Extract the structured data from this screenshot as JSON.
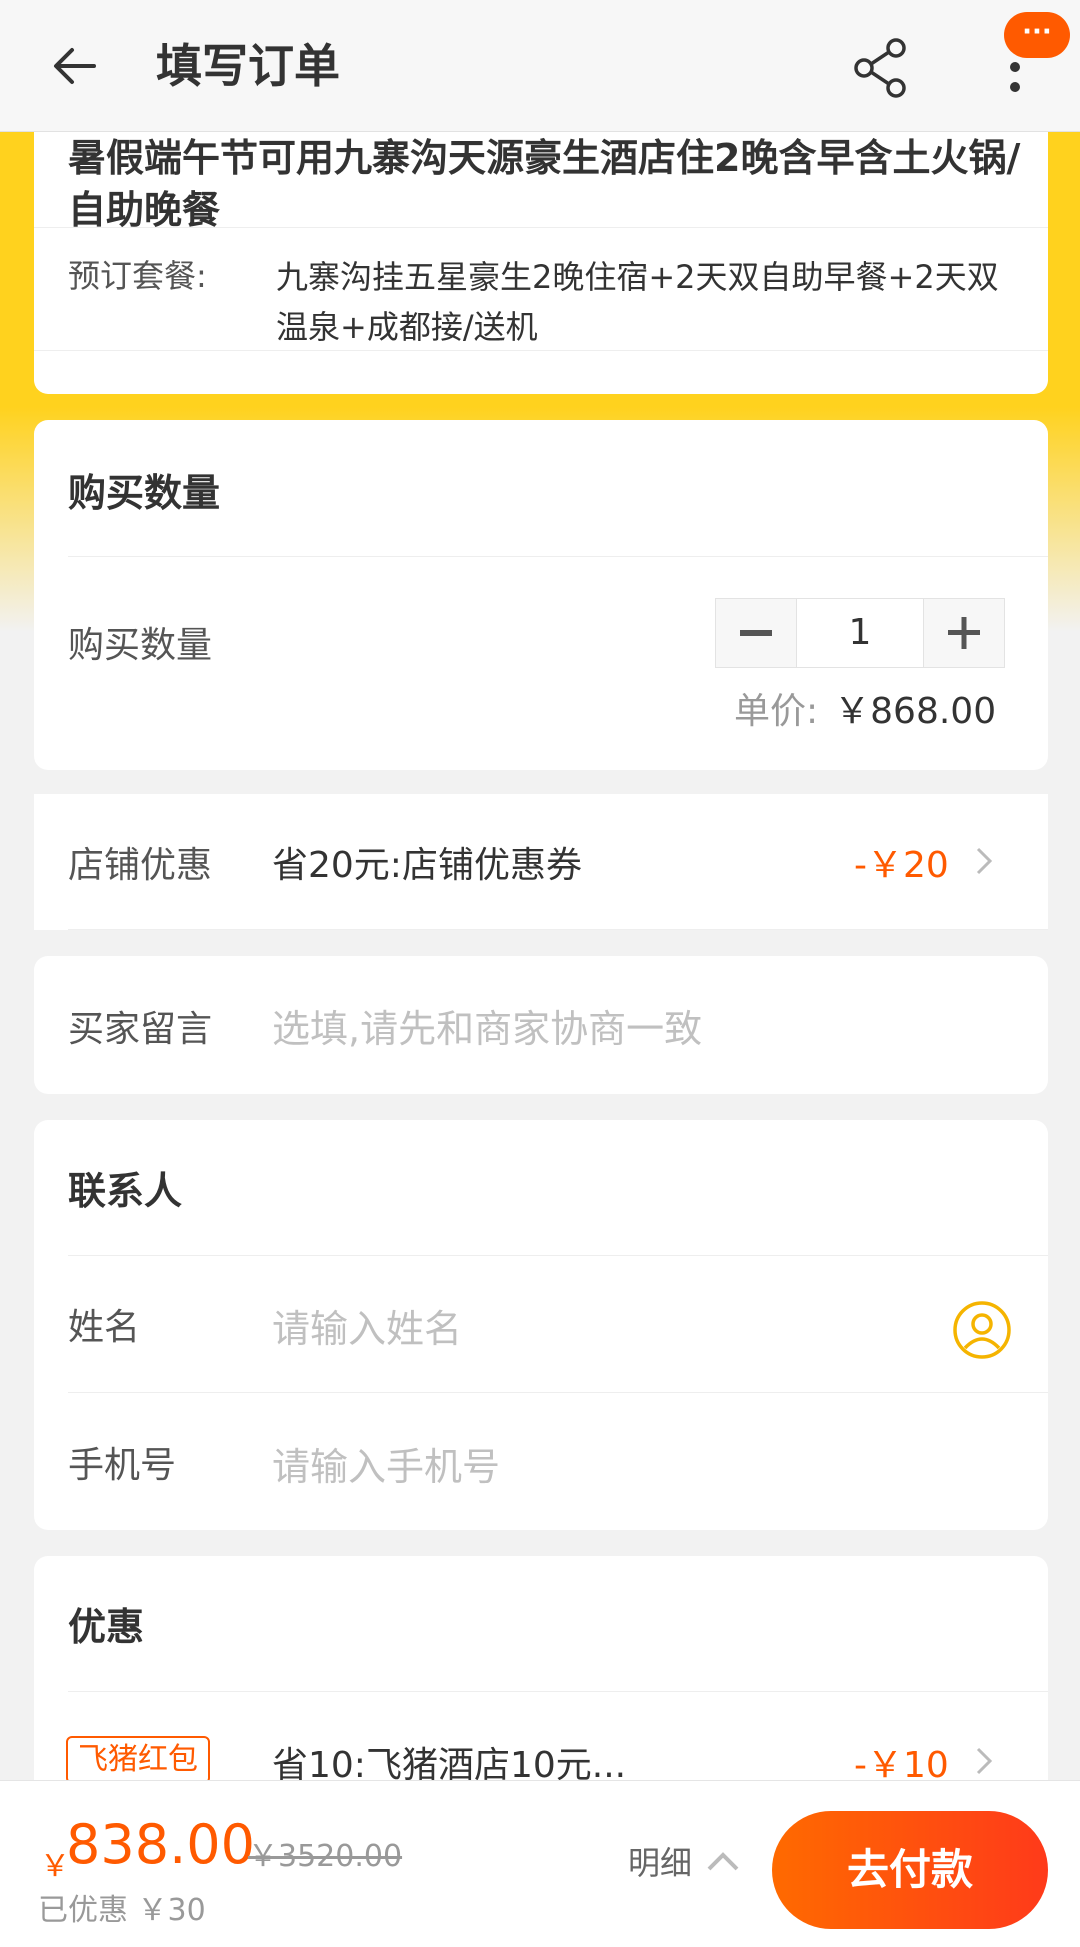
{
  "header": {
    "title": "填写订单",
    "badge": "···",
    "back_icon": "arrow-left-icon",
    "share_icon": "share-icon",
    "more_icon": "more-vertical-icon"
  },
  "product": {
    "title": "暑假端午节可用九寨沟天源豪生酒店住2晚含早含土火锅/自助晚餐",
    "package_label": "预订套餐:",
    "package_value": "九寨沟挂五星豪生2晚住宿+2天双自助早餐+2天双温泉+成都接/送机"
  },
  "quantity": {
    "section_title": "购买数量",
    "row_label": "购买数量",
    "value": "1",
    "unit_price_label": "单价:",
    "unit_price": "￥868.00"
  },
  "shop_discount": {
    "label": "店铺优惠",
    "value": "省20元:店铺优惠券",
    "amount": "-￥20"
  },
  "buyer_message": {
    "label": "买家留言",
    "placeholder": "选填,请先和商家协商一致"
  },
  "contact": {
    "section_title": "联系人",
    "name_label": "姓名",
    "name_placeholder": "请输入姓名",
    "phone_label": "手机号",
    "phone_placeholder": "请输入手机号"
  },
  "promo": {
    "section_title": "优惠",
    "tag": "飞猪红包",
    "value": "省10:飞猪酒店10元...",
    "amount": "-￥10"
  },
  "bottom": {
    "currency": "￥",
    "total": "838.00",
    "original": "￥3520.00",
    "saved": "已优惠 ￥30",
    "detail_label": "明细",
    "pay_label": "去付款"
  },
  "colors": {
    "accent": "#ff5a00",
    "yellow": "#ffd21e"
  }
}
